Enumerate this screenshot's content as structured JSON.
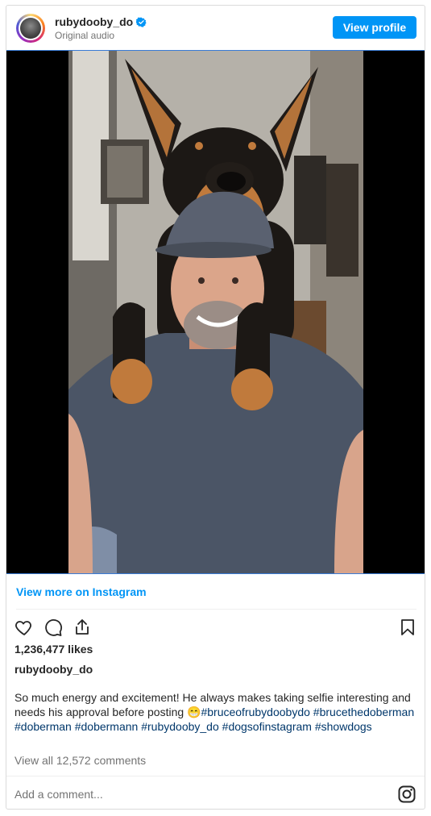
{
  "header": {
    "username": "rubydooby_do",
    "subtitle": "Original audio",
    "view_profile_label": "View profile"
  },
  "media": {
    "icon": "photo-selfie-doberman"
  },
  "links": {
    "view_more": "View more on Instagram"
  },
  "actions": {
    "icons": [
      "heart-icon",
      "comment-icon",
      "share-icon",
      "bookmark-icon"
    ]
  },
  "post": {
    "likes": "1,236,477 likes",
    "caption_user": "rubydooby_do",
    "caption_text": "So much energy and excitement! He always makes taking selfie interesting and needs his approval before posting 😁",
    "hashtags": [
      "#bruceofrubydoobydo",
      "#brucethedoberman",
      "#doberman",
      "#dobermann",
      "#rubydooby_do",
      "#dogsofinstagram",
      "#showdogs"
    ],
    "comments": "View all 12,572 comments"
  },
  "comment_box": {
    "placeholder": "Add a comment..."
  },
  "colors": {
    "accent": "#0095f6",
    "hashtag": "#00376b",
    "muted": "#737373"
  }
}
